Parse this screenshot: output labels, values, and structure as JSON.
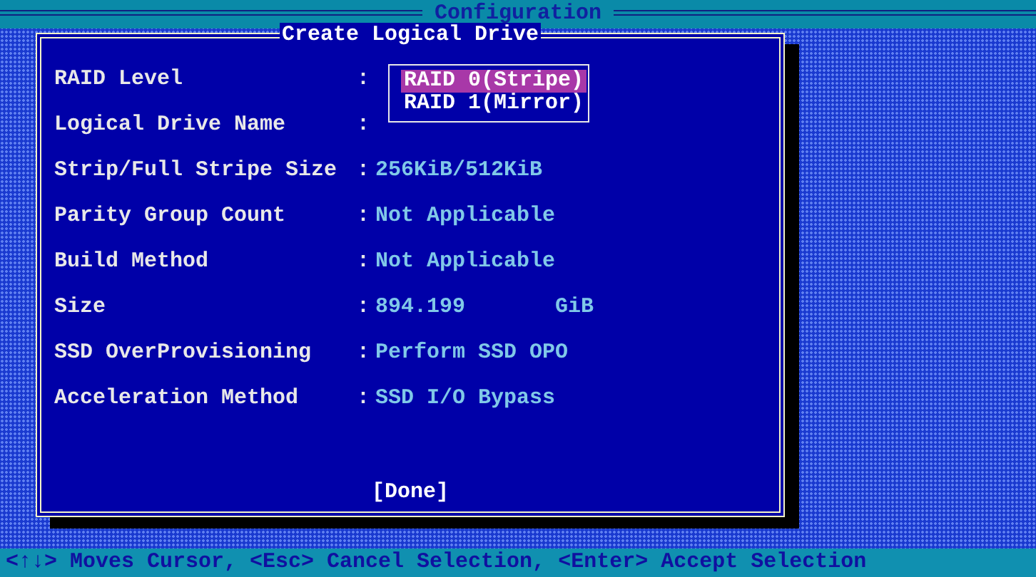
{
  "header": {
    "title": "Configuration"
  },
  "dialog": {
    "title": "Create Logical Drive",
    "fields": [
      {
        "label": "RAID Level",
        "separator": ":"
      },
      {
        "label": "Logical Drive Name",
        "separator": ":"
      },
      {
        "label": "Strip/Full Stripe Size",
        "separator": ":",
        "value": "256KiB/512KiB"
      },
      {
        "label": "Parity Group Count",
        "separator": ":",
        "value": "Not Applicable"
      },
      {
        "label": "Build Method",
        "separator": ":",
        "value": "Not Applicable"
      },
      {
        "label": "Size",
        "separator": ":",
        "value": "894.199",
        "unit": "GiB"
      },
      {
        "label": "SSD OverProvisioning",
        "separator": ":",
        "value": "Perform SSD OPO"
      },
      {
        "label": "Acceleration Method",
        "separator": ":",
        "value": "SSD I/O Bypass"
      }
    ],
    "dropdown": [
      {
        "label": "RAID 0(Stripe)",
        "selected": true
      },
      {
        "label": "RAID 1(Mirror)",
        "selected": false
      }
    ],
    "button": "[Done]"
  },
  "status_bar": "<↑↓> Moves Cursor, <Esc> Cancel Selection, <Enter> Accept Selection"
}
